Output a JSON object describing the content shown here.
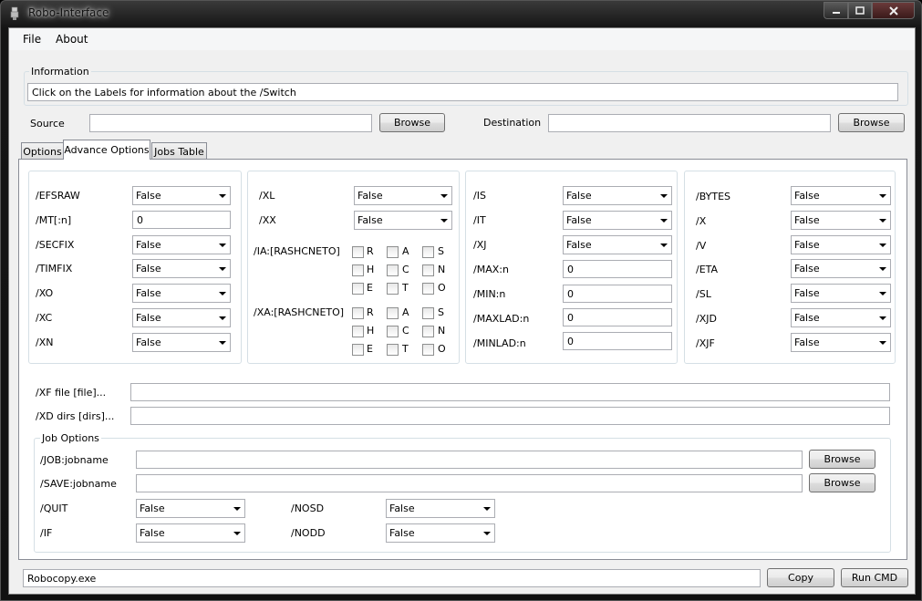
{
  "window": {
    "title": "Robo-Interface"
  },
  "menu": [
    "File",
    "About"
  ],
  "information": {
    "label": "Information",
    "text": "Click on the Labels for information about the /Switch"
  },
  "source": {
    "label": "Source",
    "value": "",
    "browse": "Browse"
  },
  "destination": {
    "label": "Destination",
    "value": "",
    "browse": "Browse"
  },
  "tabs": [
    {
      "label": "Options",
      "active": false
    },
    {
      "label": "Advance Options",
      "active": true
    },
    {
      "label": "Jobs Table",
      "active": false
    }
  ],
  "panel1": [
    {
      "label": "/EFSRAW",
      "type": "dropdown",
      "value": "False"
    },
    {
      "label": "/MT[:n]",
      "type": "text",
      "value": "0"
    },
    {
      "label": "/SECFIX",
      "type": "dropdown",
      "value": "False"
    },
    {
      "label": "/TIMFIX",
      "type": "dropdown",
      "value": "False"
    },
    {
      "label": "/XO",
      "type": "dropdown",
      "value": "False"
    },
    {
      "label": "/XC",
      "type": "dropdown",
      "value": "False"
    },
    {
      "label": "/XN",
      "type": "dropdown",
      "value": "False"
    }
  ],
  "panel2": {
    "rows": [
      {
        "label": "/XL",
        "value": "False"
      },
      {
        "label": "/XX",
        "value": "False"
      }
    ],
    "ia": {
      "label": "/IA:[RASHCNETO]",
      "letters": [
        "R",
        "A",
        "S",
        "H",
        "C",
        "N",
        "E",
        "T",
        "O"
      ]
    },
    "xa": {
      "label": "/XA:[RASHCNETO]",
      "letters": [
        "R",
        "A",
        "S",
        "H",
        "C",
        "N",
        "E",
        "T",
        "O"
      ]
    }
  },
  "panel3": [
    {
      "label": "/IS",
      "type": "dropdown",
      "value": "False"
    },
    {
      "label": "/IT",
      "type": "dropdown",
      "value": "False"
    },
    {
      "label": "/XJ",
      "type": "dropdown",
      "value": "False"
    },
    {
      "label": "/MAX:n",
      "type": "text",
      "value": "0"
    },
    {
      "label": "/MIN:n",
      "type": "text",
      "value": "0"
    },
    {
      "label": "/MAXLAD:n",
      "type": "text",
      "value": "0"
    },
    {
      "label": "/MINLAD:n",
      "type": "text",
      "value": "0"
    }
  ],
  "panel4": [
    {
      "label": "/BYTES",
      "value": "False"
    },
    {
      "label": "/X",
      "value": "False"
    },
    {
      "label": "/V",
      "value": "False"
    },
    {
      "label": "/ETA",
      "value": "False"
    },
    {
      "label": "/SL",
      "value": "False"
    },
    {
      "label": "/XJD",
      "value": "False"
    },
    {
      "label": "/XJF",
      "value": "False"
    }
  ],
  "xf": {
    "label": "/XF file [file]...",
    "value": ""
  },
  "xd": {
    "label": "/XD dirs [dirs]...",
    "value": ""
  },
  "job_options": {
    "label": "Job Options",
    "job": {
      "label": "/JOB:jobname",
      "value": "",
      "browse": "Browse"
    },
    "save": {
      "label": "/SAVE:jobname",
      "value": "",
      "browse": "Browse"
    },
    "quit": {
      "label": "/QUIT",
      "value": "False"
    },
    "if": {
      "label": "/IF",
      "value": "False"
    },
    "nosd": {
      "label": "/NOSD",
      "value": "False"
    },
    "nodd": {
      "label": "/NODD",
      "value": "False"
    }
  },
  "footer": {
    "command": "Robocopy.exe",
    "copy": "Copy",
    "run": "Run CMD"
  }
}
